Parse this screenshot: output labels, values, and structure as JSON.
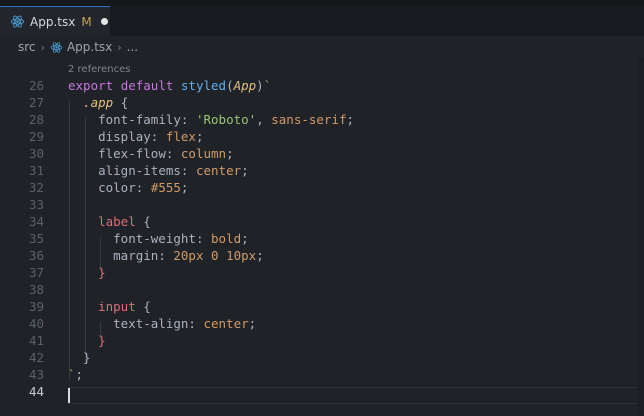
{
  "tab": {
    "filename": "App.tsx",
    "badge": "M"
  },
  "breadcrumb": {
    "folder": "src",
    "file": "App.tsx",
    "more": "..."
  },
  "codelens": "2 references",
  "active_line": 44,
  "lines": [
    {
      "num": "26",
      "tokens": [
        [
          "kw",
          "export"
        ],
        [
          "punc",
          " "
        ],
        [
          "kw",
          "default"
        ],
        [
          "punc",
          " "
        ],
        [
          "fn",
          "styled"
        ],
        [
          "punc",
          "("
        ],
        [
          "cls",
          "App"
        ],
        [
          "punc",
          ")"
        ],
        [
          "tick",
          "`"
        ]
      ]
    },
    {
      "num": "27",
      "tokens": [
        [
          "punc",
          "  "
        ],
        [
          "cls",
          ".app"
        ],
        [
          "punc",
          " {"
        ]
      ]
    },
    {
      "num": "28",
      "tokens": [
        [
          "punc",
          "    "
        ],
        [
          "prop",
          "font-family"
        ],
        [
          "punc",
          ": "
        ],
        [
          "str",
          "'Roboto'"
        ],
        [
          "punc",
          ", "
        ],
        [
          "val",
          "sans-serif"
        ],
        [
          "punc",
          ";"
        ]
      ]
    },
    {
      "num": "29",
      "tokens": [
        [
          "punc",
          "    "
        ],
        [
          "prop",
          "display"
        ],
        [
          "punc",
          ": "
        ],
        [
          "val",
          "flex"
        ],
        [
          "punc",
          ";"
        ]
      ]
    },
    {
      "num": "30",
      "tokens": [
        [
          "punc",
          "    "
        ],
        [
          "prop",
          "flex-flow"
        ],
        [
          "punc",
          ": "
        ],
        [
          "val",
          "column"
        ],
        [
          "punc",
          ";"
        ]
      ]
    },
    {
      "num": "31",
      "tokens": [
        [
          "punc",
          "    "
        ],
        [
          "prop",
          "align-items"
        ],
        [
          "punc",
          ": "
        ],
        [
          "val",
          "center"
        ],
        [
          "punc",
          ";"
        ]
      ]
    },
    {
      "num": "32",
      "tokens": [
        [
          "punc",
          "    "
        ],
        [
          "prop",
          "color"
        ],
        [
          "punc",
          ": "
        ],
        [
          "val",
          "#555"
        ],
        [
          "punc",
          ";"
        ]
      ]
    },
    {
      "num": "33",
      "tokens": []
    },
    {
      "num": "34",
      "tokens": [
        [
          "punc",
          "    "
        ],
        [
          "tag",
          "label"
        ],
        [
          "punc",
          " {"
        ]
      ]
    },
    {
      "num": "35",
      "tokens": [
        [
          "punc",
          "      "
        ],
        [
          "prop",
          "font-weight"
        ],
        [
          "punc",
          ": "
        ],
        [
          "val",
          "bold"
        ],
        [
          "punc",
          ";"
        ]
      ]
    },
    {
      "num": "36",
      "tokens": [
        [
          "punc",
          "      "
        ],
        [
          "prop",
          "margin"
        ],
        [
          "punc",
          ": "
        ],
        [
          "val",
          "20px"
        ],
        [
          "punc",
          " "
        ],
        [
          "val",
          "0"
        ],
        [
          "punc",
          " "
        ],
        [
          "val",
          "10px"
        ],
        [
          "punc",
          ";"
        ]
      ]
    },
    {
      "num": "37",
      "tokens": [
        [
          "punc",
          "    "
        ],
        [
          "brace",
          "}"
        ]
      ]
    },
    {
      "num": "38",
      "tokens": []
    },
    {
      "num": "39",
      "tokens": [
        [
          "punc",
          "    "
        ],
        [
          "tag",
          "input"
        ],
        [
          "punc",
          " {"
        ]
      ]
    },
    {
      "num": "40",
      "tokens": [
        [
          "punc",
          "      "
        ],
        [
          "prop",
          "text-align"
        ],
        [
          "punc",
          ": "
        ],
        [
          "val",
          "center"
        ],
        [
          "punc",
          ";"
        ]
      ]
    },
    {
      "num": "41",
      "tokens": [
        [
          "punc",
          "    "
        ],
        [
          "brace",
          "}"
        ]
      ]
    },
    {
      "num": "42",
      "tokens": [
        [
          "punc",
          "  }"
        ]
      ]
    },
    {
      "num": "43",
      "tokens": [
        [
          "tick",
          "`"
        ],
        [
          "punc",
          ";"
        ]
      ]
    },
    {
      "num": "44",
      "tokens": []
    }
  ],
  "colors": {
    "background": "#1f2227",
    "tab_accent": "#2c70c8",
    "react_blue": "#4fa6e0"
  },
  "icons": {
    "file_icon": "react-icon",
    "separator": "chevron-right-icon",
    "unsaved": "dot-icon"
  }
}
